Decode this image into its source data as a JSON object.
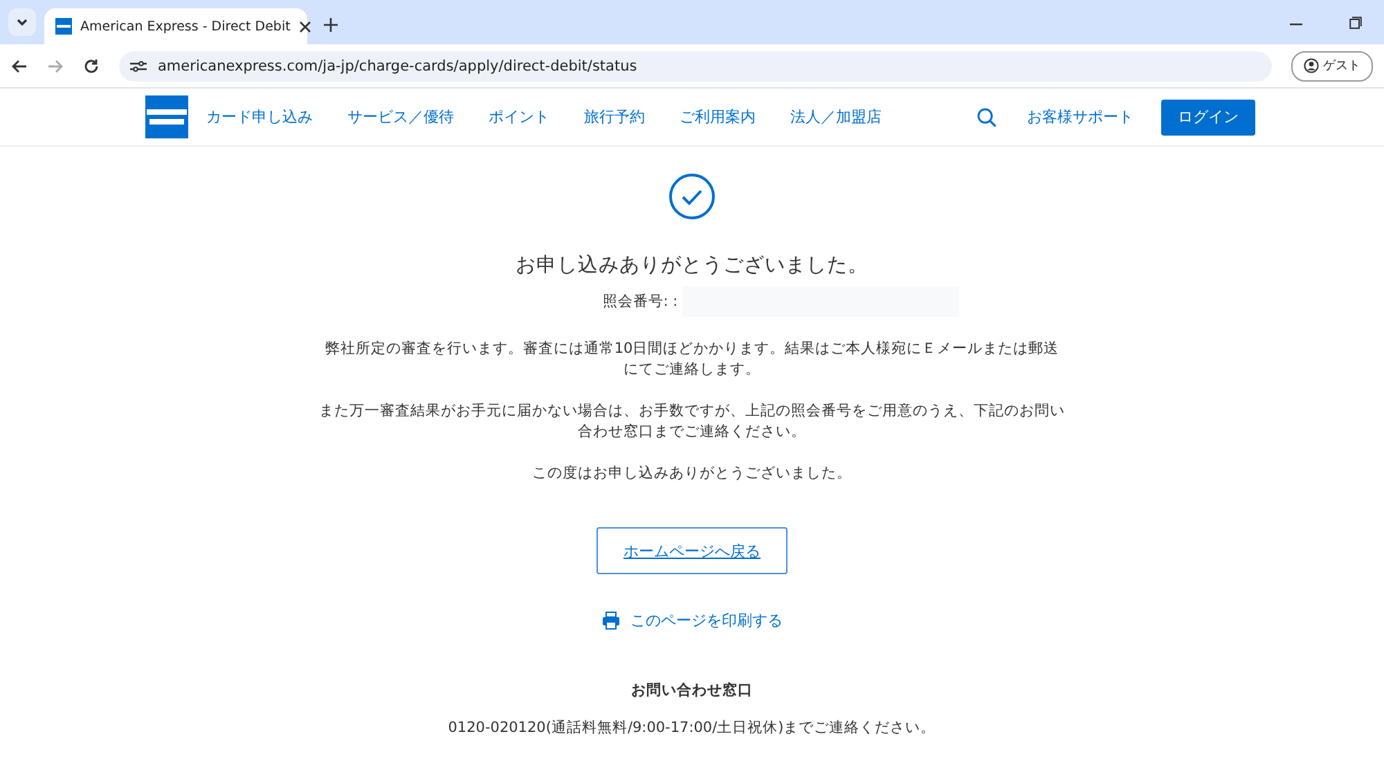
{
  "browser": {
    "tab_title": "American Express - Direct Debit",
    "address": "americanexpress.com/ja-jp/charge-cards/apply/direct-debit/status",
    "profile": "ゲスト"
  },
  "header": {
    "nav": [
      {
        "label": "カード申し込み"
      },
      {
        "label": "サービス／優待"
      },
      {
        "label": "ポイント"
      },
      {
        "label": "旅行予約"
      },
      {
        "label": "ご利用案内"
      },
      {
        "label": "法人／加盟店"
      }
    ],
    "support": "お客様サポート",
    "login": "ログイン"
  },
  "content": {
    "title": "お申し込みありがとうございました。",
    "reference_label": "照会番号: :",
    "paragraphs": [
      "弊社所定の審査を行います。審査には通常10日間ほどかかります。結果はご本人様宛にＥメールまたは郵送にてご連絡します。",
      "また万一審査結果がお手元に届かない場合は、お手数ですが、上記の照会番号をご用意のうえ、下記のお問い合わせ窓口までご連絡ください。",
      "この度はお申し込みありがとうございました。"
    ],
    "home_button": "ホームページへ戻る",
    "print_link": "このページを印刷する",
    "contact": {
      "heading": "お問い合わせ窓口",
      "text": "0120-020120(通話料無料/9:00-17:00/土日祝休)までご連絡ください。"
    }
  }
}
